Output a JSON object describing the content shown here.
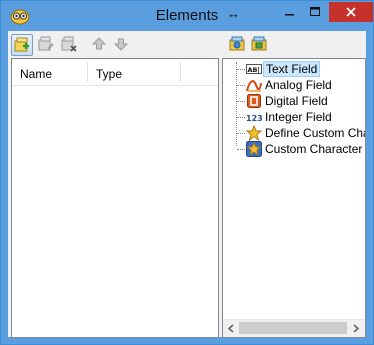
{
  "window": {
    "title": "Elements",
    "resize_glyph": "↔",
    "minimize_glyph": "—",
    "maximize_glyph": "☐",
    "close_glyph": "✕"
  },
  "toolbar": {
    "left": [
      {
        "icon": "new-element-icon",
        "active": true
      },
      {
        "icon": "edit-element-icon",
        "active": false
      },
      {
        "icon": "delete-element-icon",
        "active": false
      },
      {
        "icon": "move-up-icon",
        "active": false
      },
      {
        "icon": "move-down-icon",
        "active": false
      }
    ],
    "right": [
      {
        "icon": "add-field-icon"
      },
      {
        "icon": "field-properties-icon"
      }
    ]
  },
  "table": {
    "columns": [
      "Name",
      "Type"
    ],
    "rows": []
  },
  "tree": {
    "items": [
      {
        "label": "Text Field",
        "icon": "text-field-icon",
        "selected": true
      },
      {
        "label": "Analog Field",
        "icon": "analog-field-icon",
        "selected": false
      },
      {
        "label": "Digital Field",
        "icon": "digital-field-icon",
        "selected": false
      },
      {
        "label": "Integer Field",
        "icon": "integer-field-icon",
        "selected": false
      },
      {
        "label": "Define Custom Chara",
        "icon": "define-custom-icon",
        "selected": false
      },
      {
        "label": "Custom Character Fi",
        "icon": "custom-character-icon",
        "selected": false
      }
    ]
  },
  "colors": {
    "titlebar": "#5a9ee0",
    "close": "#c7312b",
    "selection": "#cce8ff"
  }
}
